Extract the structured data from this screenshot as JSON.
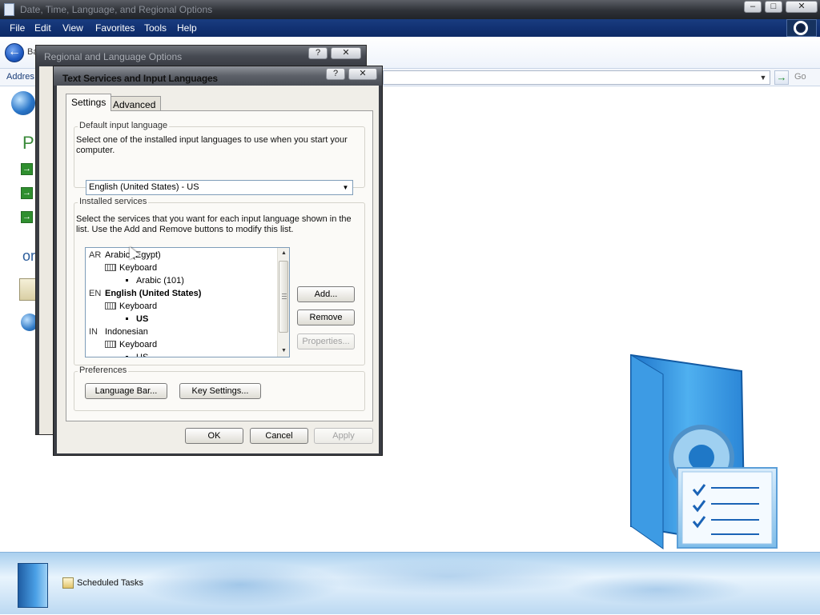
{
  "main_window": {
    "title": "Date, Time, Language, and Regional Options",
    "menu": [
      "File",
      "Edit",
      "View",
      "Favorites",
      "Tools",
      "Help"
    ],
    "back_label": "Ba",
    "address_label": "Addres",
    "go_label": "Go"
  },
  "task_panel": {
    "pick_fragment": "Pi",
    "or_fragment": "or"
  },
  "taskbar": {
    "scheduled_tasks_label": "Scheduled Tasks"
  },
  "rlo_dialog": {
    "title": "Regional and Language Options"
  },
  "ts_dialog": {
    "title": "Text Services and Input Languages",
    "help_btn": "?",
    "close_btn": "✕",
    "tabs": [
      "Settings",
      "Advanced"
    ],
    "default_group": {
      "label": "Default input language",
      "desc": "Select one of the installed input languages to use when you start your computer.",
      "selected": "English (United States) - US"
    },
    "installed_group": {
      "label": "Installed services",
      "desc": "Select the services that you want for each input language shown in the list. Use the Add and Remove buttons to modify this list.",
      "tree": [
        {
          "code": "AR",
          "label": "Arabic (Egypt)"
        },
        {
          "label": "Keyboard"
        },
        {
          "label": "Arabic (101)"
        },
        {
          "code": "EN",
          "label": "English (United States)"
        },
        {
          "label": "Keyboard"
        },
        {
          "label": "US"
        },
        {
          "code": "IN",
          "label": "Indonesian"
        },
        {
          "label": "Keyboard"
        },
        {
          "label": "US"
        }
      ],
      "add_btn": "Add...",
      "remove_btn": "Remove",
      "properties_btn": "Properties..."
    },
    "preferences_group": {
      "label": "Preferences",
      "language_bar_btn": "Language Bar...",
      "key_settings_btn": "Key Settings..."
    },
    "ok_btn": "OK",
    "cancel_btn": "Cancel",
    "apply_btn": "Apply"
  }
}
